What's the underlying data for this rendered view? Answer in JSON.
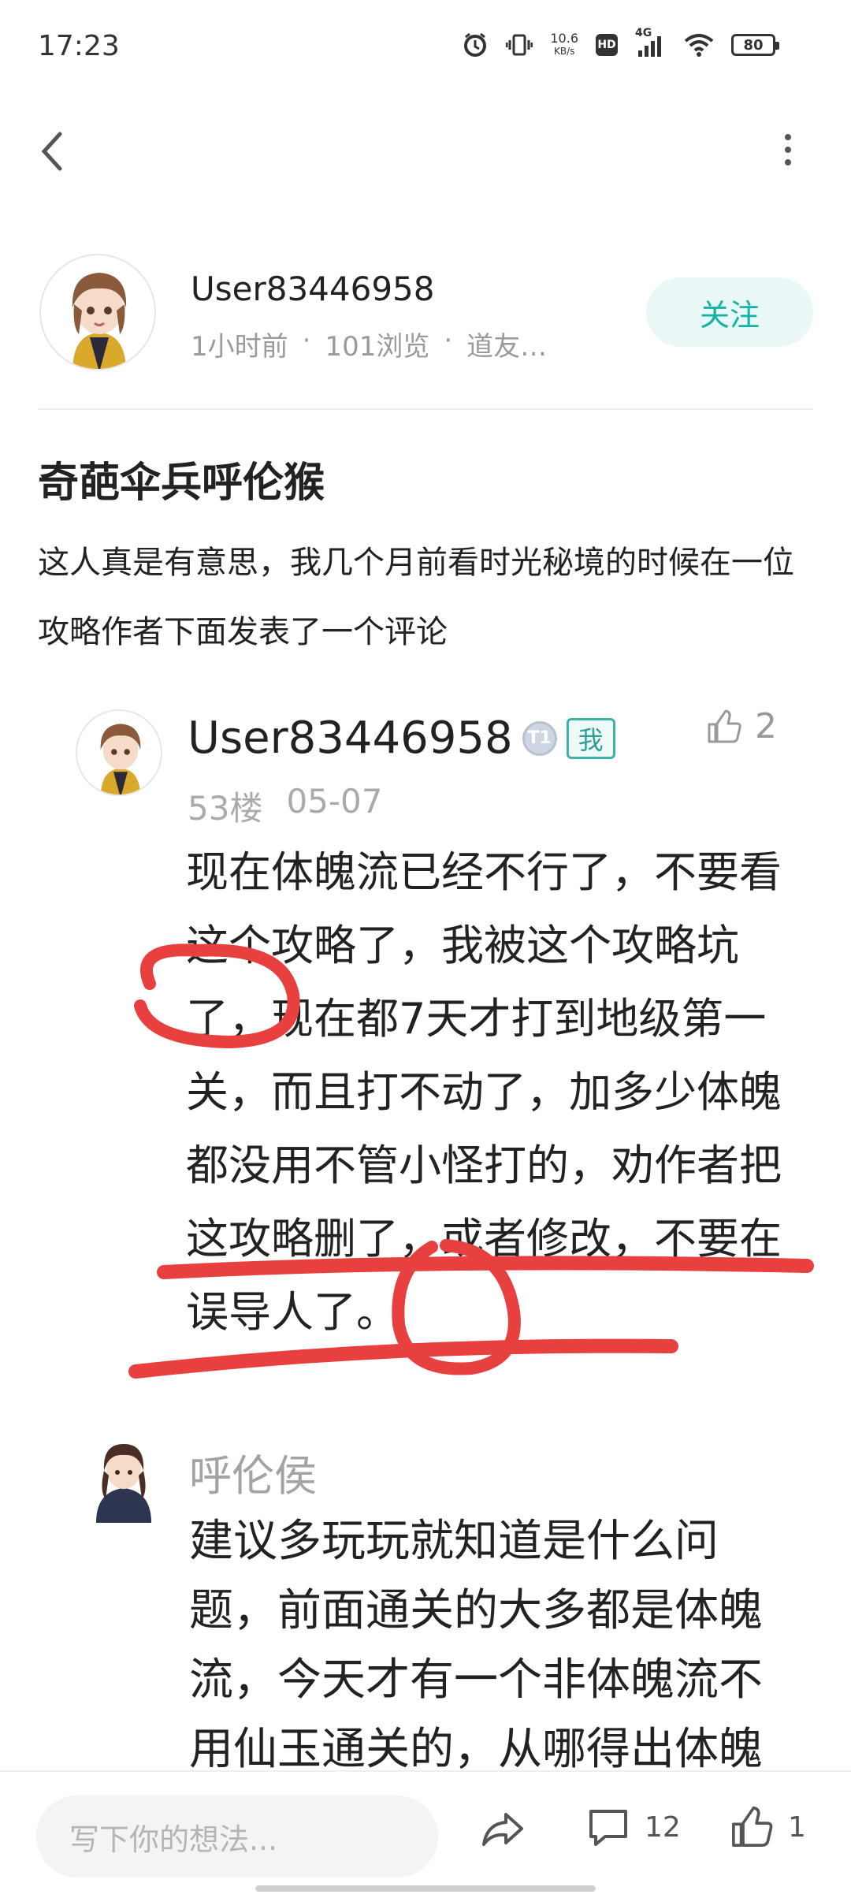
{
  "status_bar": {
    "time": "17:23",
    "net_speed_value": "10.6",
    "net_speed_unit": "KB/s",
    "hd": "HD",
    "network": "4G",
    "battery": "80"
  },
  "author": {
    "name": "User83446958",
    "meta": [
      "1小时前",
      "·",
      "101浏览",
      "·",
      "道友…"
    ],
    "follow_label": "关注"
  },
  "post": {
    "title": "奇葩伞兵呼伦猴",
    "body": "这人真是有意思，我几个月前看时光秘境的时候在一位攻略作者下面发表了一个评论"
  },
  "screenshot_comment": {
    "user": "User83446958",
    "level": "T1",
    "me_badge": "我",
    "likes": "2",
    "floor": "53楼",
    "date": "05-07",
    "text": "现在体魄流已经不行了，不要看这个攻略了，我被这个攻略坑了，现在都7天才打到地级第一关，而且打不动了，加多少体魄都没用不管小怪打的，劝作者把这攻略删了，或者修改，不要在误导人了。"
  },
  "screenshot_reply": {
    "user": "呼伦侯",
    "text": "建议多玩玩就知道是什么问题，前面通关的大多都是体魄流，今天才有一个非体魄流不用仙玉通关的，从哪得出体魄"
  },
  "bottom_bar": {
    "input_placeholder": "写下你的想法...",
    "comments_count": "12",
    "likes_count": "1"
  },
  "colors": {
    "accent": "#12b3a6",
    "annotation_red": "#e8403f"
  }
}
